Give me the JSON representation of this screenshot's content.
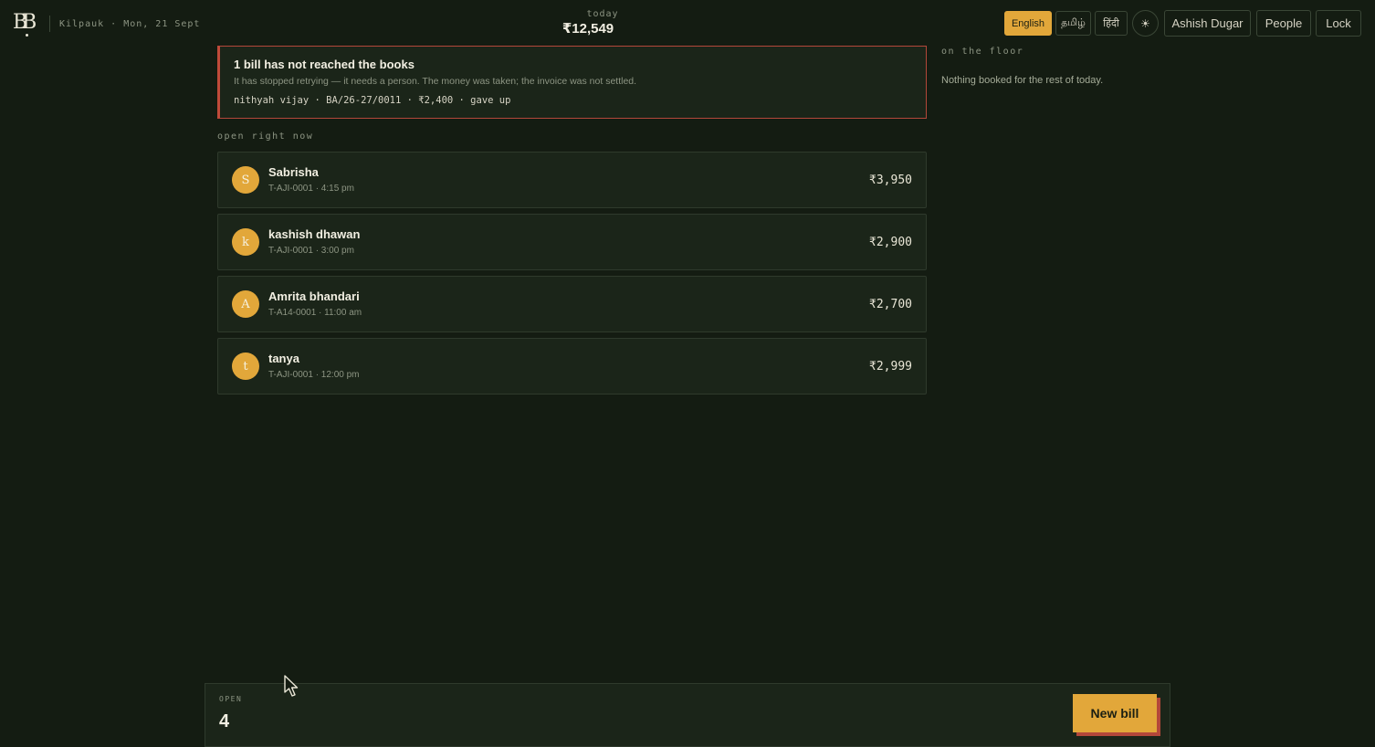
{
  "header": {
    "logo_text": "BB",
    "location": "Kilpauk · Mon, 21 Sept",
    "today_label": "today",
    "today_amount": "₹12,549",
    "languages": [
      "English",
      "தமிழ்",
      "हिंदी"
    ],
    "active_language": "English",
    "theme_icon": "sun-icon",
    "theme_glyph": "☀",
    "user": "Ashish Dugar",
    "people": "People",
    "lock": "Lock"
  },
  "alert": {
    "title": "1 bill has not reached the books",
    "body": "It has stopped retrying — it needs a person. The money was taken; the invoice was not settled.",
    "detail": "nithyah vijay · BA/26-27/0011 · ₹2,400 · gave up"
  },
  "open_section": {
    "label": "open right now",
    "bills": [
      {
        "initial": "S",
        "name": "Sabrisha",
        "meta": "T-AJI-0001 · 4:15 pm",
        "amount": "₹3,950"
      },
      {
        "initial": "k",
        "name": "kashish dhawan",
        "meta": "T-AJI-0001 · 3:00 pm",
        "amount": "₹2,900"
      },
      {
        "initial": "A",
        "name": "Amrita bhandari",
        "meta": "T-A14-0001 · 11:00 am",
        "amount": "₹2,700"
      },
      {
        "initial": "t",
        "name": "tanya",
        "meta": "T-AJI-0001 · 12:00 pm",
        "amount": "₹2,999"
      }
    ]
  },
  "floor": {
    "label": "on the floor",
    "text": "Nothing booked for the rest of today."
  },
  "footer": {
    "open_label": "OPEN",
    "open_count": "4",
    "new_bill": "New bill"
  },
  "colors": {
    "background": "#141c12",
    "card": "#1b2519",
    "accent": "#e2a73a",
    "alert": "#c04a3a"
  }
}
